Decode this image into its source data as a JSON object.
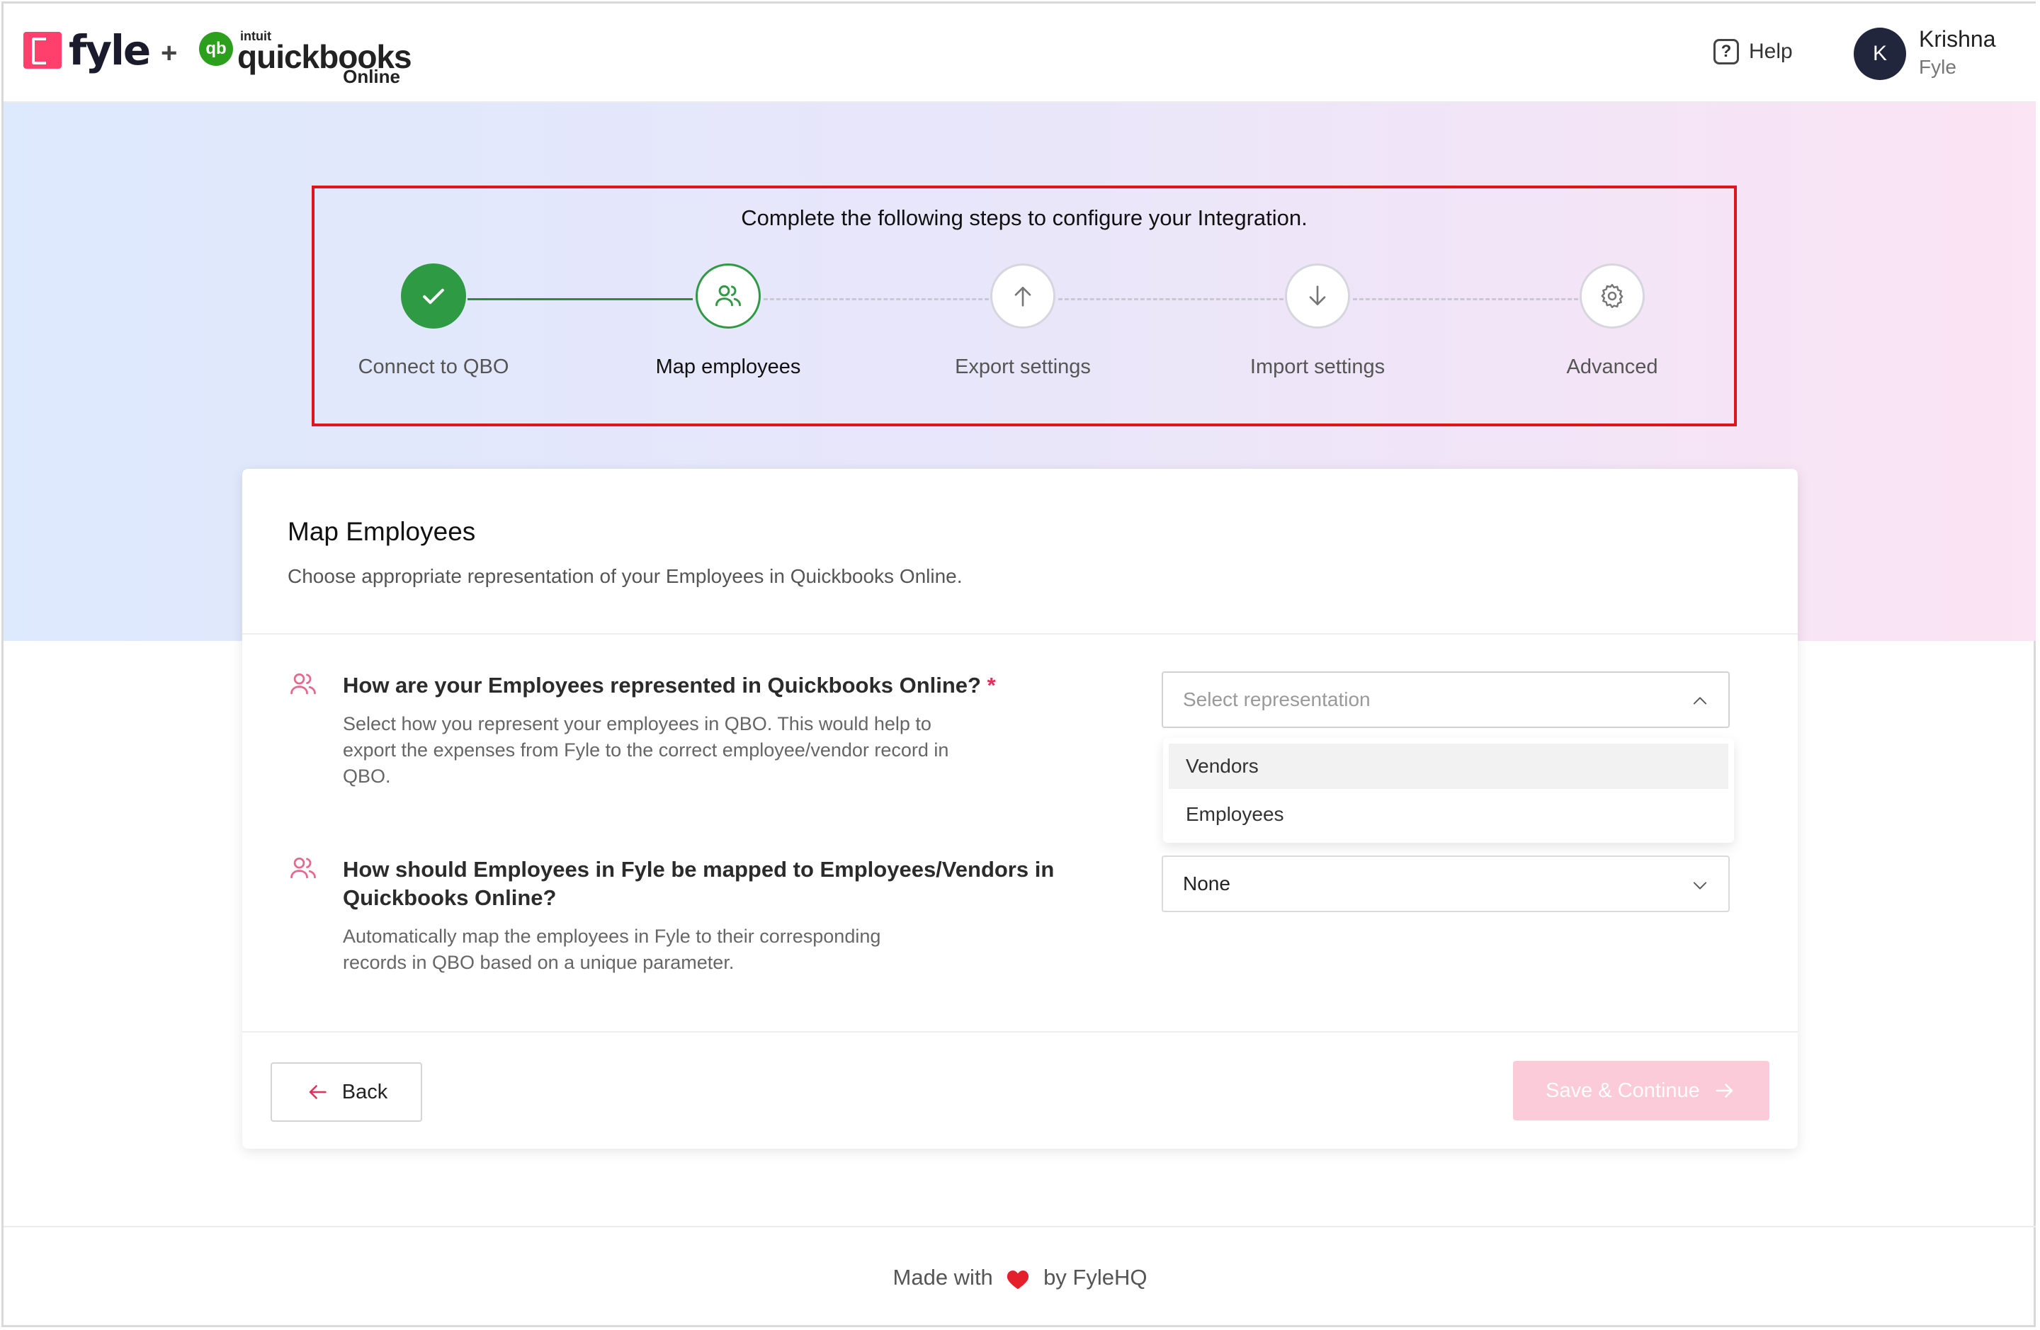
{
  "header": {
    "fyle_logo_text": "fyle",
    "plus": "+",
    "qb_intuit": "intuit",
    "qb_word": "quickbooks",
    "qb_online": "Online",
    "qb_mark": "qb",
    "help_label": "Help",
    "user": {
      "initial": "K",
      "name": "Krishna",
      "org": "Fyle"
    }
  },
  "stepper": {
    "title": "Complete the following steps to configure your Integration.",
    "steps": [
      {
        "label": "Connect to QBO",
        "state": "done",
        "icon": "check-icon"
      },
      {
        "label": "Map employees",
        "state": "active",
        "icon": "users-icon"
      },
      {
        "label": "Export settings",
        "state": "todo",
        "icon": "arrow-up-icon"
      },
      {
        "label": "Import settings",
        "state": "todo",
        "icon": "arrow-down-icon"
      },
      {
        "label": "Advanced",
        "state": "todo",
        "icon": "gear-icon"
      }
    ]
  },
  "card": {
    "title": "Map Employees",
    "subtitle": "Choose appropriate representation of your Employees in Quickbooks Online.",
    "q1": {
      "title": "How are your Employees represented in Quickbooks Online?",
      "required_mark": "*",
      "desc_lines": [
        "Select how you represent your employees in QBO. This would help to",
        "export the expenses from Fyle to the correct employee/vendor record in",
        "QBO."
      ],
      "placeholder": "Select representation",
      "options": [
        "Vendors",
        "Employees"
      ]
    },
    "q2": {
      "title_lines": [
        "How should Employees in Fyle be mapped to Employees/Vendors in",
        "Quickbooks Online?"
      ],
      "desc_lines": [
        "Automatically map the employees in Fyle to their corresponding",
        "records in QBO based on a unique parameter."
      ],
      "value": "None"
    },
    "back_label": "Back",
    "save_label": "Save & Continue"
  },
  "footer": {
    "before": "Made with",
    "after": "by FyleHQ"
  },
  "colors": {
    "brand_pink": "#ff3f6c",
    "qb_green": "#2ca01c",
    "step_green": "#2e9a44",
    "highlight_red": "#e0151b",
    "save_disabled": "#fccbd9"
  }
}
